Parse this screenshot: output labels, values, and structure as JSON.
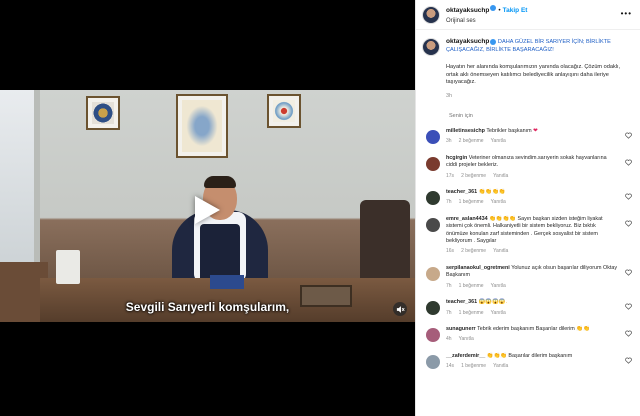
{
  "video": {
    "subtitle": "Sevgili Sarıyerli komşularım,"
  },
  "header": {
    "username": "oktayaksuchp",
    "follow_label": "Takip Et",
    "audio_label": "Orijinal ses",
    "more_label": "•••"
  },
  "caption": {
    "username": "oktayaksuchp",
    "title": "DAHA GÜZEL BİR SARIYER İÇİN; BİRLİKTE ÇALIŞACAĞIZ, BİRLİKTE BAŞARACAĞIZ!",
    "body": "Hayatın her alanında komşularımızın yanında olacağız. Çözüm odaklı, ortak aklı önemseyen katılımcı belediyecilik anlayışını daha ileriye taşıyacağız.",
    "time": "3h"
  },
  "for_you_label": "Senin için",
  "comments": [
    {
      "user": "milletinsesichp",
      "text": "Tebrikler başkanım",
      "suffix": "❤",
      "time": "3h",
      "likes": "2 beğenme",
      "reply": "Yanıtla",
      "avatar_color": "#3b4fb8"
    },
    {
      "user": "hcgirgin",
      "text": "Veteriner olmanıza sevindim.sarıyerin sokak hayvanlarına ciddi projeler bekleriz.",
      "suffix": "",
      "time": "17s",
      "likes": "2 beğenme",
      "reply": "Yanıtla",
      "avatar_color": "#7a3b2e"
    },
    {
      "user": "teacher_361",
      "text": "",
      "suffix": "👏👏👏👏",
      "time": "7h",
      "likes": "1 beğenme",
      "reply": "Yanıtla",
      "avatar_color": "#2f3a2f"
    },
    {
      "user": "emre_aslan4434",
      "text": "👏👏👏👏 Sayın başkan sizden isteğim liyakat sistemi çok önemli. Halkaniyetli bir sistem bekliyoruz. Biz bıktık önümüze konulan zarf sisteminden . Gerçek sosyalist bir sistem bekliyorum . Saygılar",
      "suffix": "",
      "time": "16s",
      "likes": "2 beğenme",
      "reply": "Yanıtla",
      "avatar_color": "#4a4a4a"
    },
    {
      "user": "serpilanaokul_ogretmeni",
      "text": "Yolunuz açık olsun başarılar diliyorum Oktay Başkanım",
      "suffix": "",
      "time": "7h",
      "likes": "1 beğenme",
      "reply": "Yanıtla",
      "avatar_color": "#c7a98a"
    },
    {
      "user": "teacher_361",
      "text": "",
      "suffix": "😱😱😱😱.",
      "time": "7h",
      "likes": "1 beğenme",
      "reply": "Yanıtla",
      "avatar_color": "#2f3a2f"
    },
    {
      "user": "sunagunerr",
      "text": "Tebrik ederim başkanım Başarılar dilerim",
      "suffix": "👏👏",
      "time": "4h",
      "likes": "",
      "reply": "Yanıtla",
      "avatar_color": "#a65d7a"
    },
    {
      "user": "__zaferdemir__",
      "text": "",
      "suffix": "👏👏👏 Başarılar dilerim başkanım",
      "time": "14s",
      "likes": "1 beğenme",
      "reply": "Yanıtla",
      "avatar_color": "#8b9aa8"
    }
  ]
}
